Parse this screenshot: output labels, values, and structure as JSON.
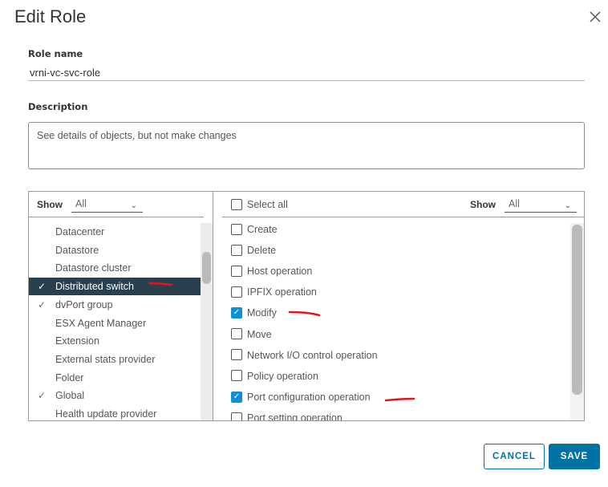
{
  "dialog": {
    "title": "Edit Role",
    "close_icon": "close-icon"
  },
  "role_name": {
    "label": "Role name",
    "value": "vrni-vc-svc-role"
  },
  "description": {
    "label": "Description",
    "value": "See details of objects, but not make changes"
  },
  "left_panel": {
    "show_label": "Show",
    "filter_value": "All",
    "items": [
      {
        "label": "Datacenter",
        "checked": false,
        "selected": false
      },
      {
        "label": "Datastore",
        "checked": false,
        "selected": false
      },
      {
        "label": "Datastore cluster",
        "checked": false,
        "selected": false
      },
      {
        "label": "Distributed switch",
        "checked": true,
        "selected": true
      },
      {
        "label": "dvPort group",
        "checked": true,
        "selected": false
      },
      {
        "label": "ESX Agent Manager",
        "checked": false,
        "selected": false
      },
      {
        "label": "Extension",
        "checked": false,
        "selected": false
      },
      {
        "label": "External stats provider",
        "checked": false,
        "selected": false
      },
      {
        "label": "Folder",
        "checked": false,
        "selected": false
      },
      {
        "label": "Global",
        "checked": true,
        "selected": false
      },
      {
        "label": "Health update provider",
        "checked": false,
        "selected": false
      }
    ]
  },
  "right_panel": {
    "select_all_label": "Select all",
    "show_label": "Show",
    "filter_value": "All",
    "items": [
      {
        "label": "Create",
        "checked": false
      },
      {
        "label": "Delete",
        "checked": false
      },
      {
        "label": "Host operation",
        "checked": false
      },
      {
        "label": "IPFIX operation",
        "checked": false
      },
      {
        "label": "Modify",
        "checked": true
      },
      {
        "label": "Move",
        "checked": false
      },
      {
        "label": "Network I/O control operation",
        "checked": false
      },
      {
        "label": "Policy operation",
        "checked": false
      },
      {
        "label": "Port configuration operation",
        "checked": true
      },
      {
        "label": "Port setting operation",
        "checked": false
      }
    ]
  },
  "footer": {
    "cancel_label": "CANCEL",
    "save_label": "SAVE"
  },
  "colors": {
    "accent": "#0072a3",
    "checkbox": "#0e90d6",
    "selected_row": "#29414e",
    "annotation": "#e0161b"
  }
}
